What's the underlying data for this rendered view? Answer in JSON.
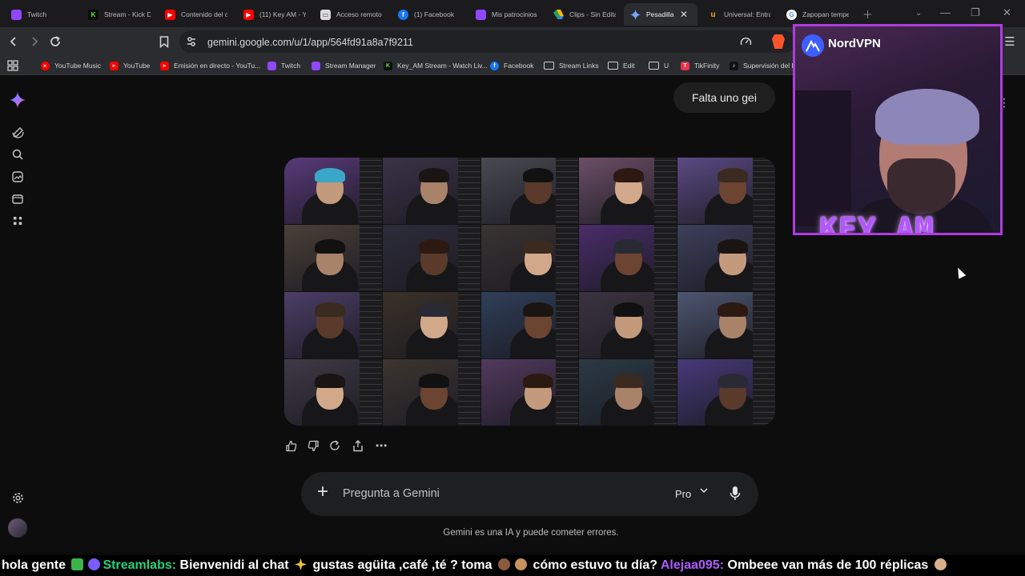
{
  "browser": {
    "tabs": [
      {
        "title": "Twitch",
        "favicon": "twitch-icon",
        "color": "#9146ff"
      },
      {
        "title": "Stream - Kick D",
        "favicon": "kick-icon",
        "color": "#53fc18"
      },
      {
        "title": "Contenido del c",
        "favicon": "youtube-icon",
        "color": "#ff0000"
      },
      {
        "title": "(11) Key AM - Y",
        "favicon": "youtube-icon",
        "color": "#ff0000"
      },
      {
        "title": "Acceso remoto",
        "favicon": "remote-icon",
        "color": "#8ab4f8"
      },
      {
        "title": "(1) Facebook",
        "favicon": "facebook-icon",
        "color": "#1877f2"
      },
      {
        "title": "Mis patrocinios",
        "favicon": "twitch-icon",
        "color": "#9146ff"
      },
      {
        "title": "Clips - Sin Edita",
        "favicon": "drive-icon",
        "color": "#1fa463"
      },
      {
        "title": "Pesadilla",
        "favicon": "gemini-icon",
        "color": "#6aa0ff"
      },
      {
        "title": "Universal: Entra",
        "favicon": "universal-icon",
        "color": "#f0a030"
      },
      {
        "title": "Zapopan tempe",
        "favicon": "google-icon",
        "color": "#ffffff"
      }
    ],
    "url": "gemini.google.com/u/1/app/564fd91a8a7f9211",
    "bookmarks": [
      {
        "label": "YouTube Music",
        "icon": "youtube-music-icon",
        "color": "#ff0000"
      },
      {
        "label": "YouTube",
        "icon": "youtube-icon",
        "color": "#ff0000"
      },
      {
        "label": "Emisión en directo - YouTu...",
        "icon": "youtube-icon",
        "color": "#ff0000"
      },
      {
        "label": "Twitch",
        "icon": "twitch-icon",
        "color": "#9146ff"
      },
      {
        "label": "Stream Manager",
        "icon": "twitch-icon",
        "color": "#9146ff"
      },
      {
        "label": "Key_AM Stream - Watch Liv...",
        "icon": "kick-icon",
        "color": "#53fc18"
      },
      {
        "label": "Facebook",
        "icon": "facebook-icon",
        "color": "#1877f2"
      },
      {
        "label": "Stream Links",
        "icon": "folder-icon",
        "color": "#cfcfcf"
      },
      {
        "label": "Edit",
        "icon": "folder-icon",
        "color": "#cfcfcf"
      },
      {
        "label": "U",
        "icon": "folder-icon",
        "color": "#cfcfcf"
      },
      {
        "label": "TikFinity",
        "icon": "tikfinity-icon",
        "color": "#e8344b"
      },
      {
        "label": "Supervisión del LI",
        "icon": "tiktok-icon",
        "color": "#ffffff"
      }
    ]
  },
  "gemini": {
    "user_message": "Falta uno gei",
    "composer_placeholder": "Pregunta a Gemini",
    "mode_label": "Pro",
    "disclaimer": "Gemini es una IA y puede cometer errores."
  },
  "overlay": {
    "sponsor": "NordVPN",
    "streamer_name": "KEY_AM"
  },
  "ticker": {
    "line1": "hola gente",
    "user1": "Streamlabs:",
    "msg1a": "Bienvenidi al chat",
    "msg1b": "gustas agüita ,café ,té ? toma",
    "msg1c": "cómo estuvo tu día?",
    "user2": "Alejaa095:",
    "msg2": "Ombeee van más de 100 réplicas"
  },
  "collage_palette": [
    [
      "#5a3a7a",
      "#3a3347",
      "#4a4a52",
      "#6b4f66",
      "#5b4a83"
    ],
    [
      "#4a4038",
      "#2d2c3a",
      "#3a3332",
      "#4a2d6a",
      "#3d3f5c"
    ],
    [
      "#4d3e66",
      "#3a3128",
      "#2f3f5a",
      "#3b3440",
      "#4d5670"
    ],
    [
      "#3e3a46",
      "#3d3630",
      "#523a5e",
      "#2b3a44",
      "#463a7a"
    ]
  ]
}
